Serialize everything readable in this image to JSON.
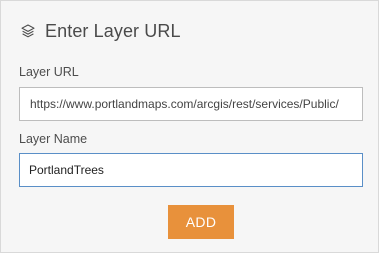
{
  "panel": {
    "title": "Enter Layer URL",
    "header_icon": "layers-icon"
  },
  "layer_url": {
    "label": "Layer URL",
    "value": "https://www.portlandmaps.com/arcgis/rest/services/Public/"
  },
  "layer_name": {
    "label": "Layer Name",
    "value": "PortlandTrees"
  },
  "actions": {
    "add_label": "ADD"
  },
  "colors": {
    "accent": "#e8913b",
    "focus_border": "#5a8fc7",
    "panel_bg": "#f6f6f6"
  }
}
